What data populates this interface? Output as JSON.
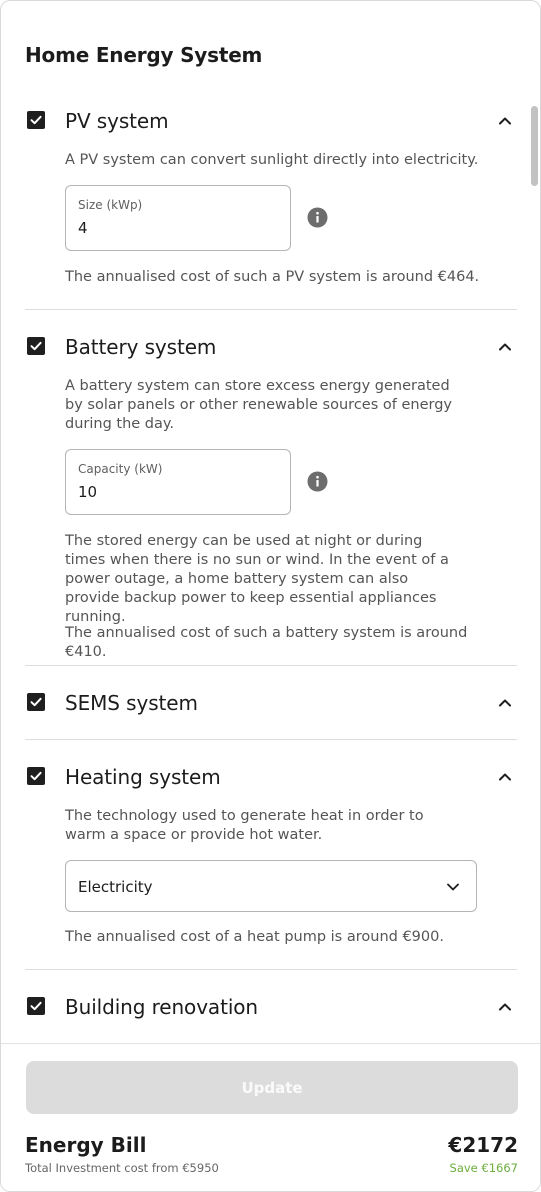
{
  "page": {
    "title": "Home Energy System"
  },
  "sections": [
    {
      "title": "PV system",
      "checked": true,
      "expanded": true,
      "description": "A PV system can convert sunlight directly into electricity.",
      "field": {
        "label": "Size (kWp)",
        "value": "4"
      },
      "notes": [
        "The annualised cost of such a PV system is around €464."
      ]
    },
    {
      "title": "Battery system",
      "checked": true,
      "expanded": true,
      "description": "A battery system can store excess energy generated by solar panels or other renewable sources of energy during the day.",
      "field": {
        "label": "Capacity (kW)",
        "value": "10"
      },
      "notes": [
        "The stored energy can be used at night or during times when there is no sun or wind. In the event of a power outage, a home battery system can also provide backup power to keep essential appliances running.",
        "The annualised cost of such a battery system is around €410."
      ]
    },
    {
      "title": "SEMS system",
      "checked": true,
      "expanded": false
    },
    {
      "title": "Heating system",
      "checked": true,
      "expanded": true,
      "description": "The technology used to generate heat in order to warm a space or provide hot water.",
      "select": {
        "value": "Electricity"
      },
      "notes": [
        "The annualised cost of a heat pump is around €900."
      ]
    },
    {
      "title": "Building renovation",
      "checked": true,
      "expanded": true
    }
  ],
  "footer": {
    "update_label": "Update",
    "bill_title": "Energy Bill",
    "bill_amount": "€2172",
    "investment_text": "Total Investment cost from €5950",
    "save_text": "Save €1667",
    "save_color": "#6cae3e"
  },
  "icons": {
    "checkbox": "checkbox-checked-icon",
    "chevron": "chevron-up-icon",
    "info": "info-icon",
    "select": "chevron-down-icon"
  }
}
